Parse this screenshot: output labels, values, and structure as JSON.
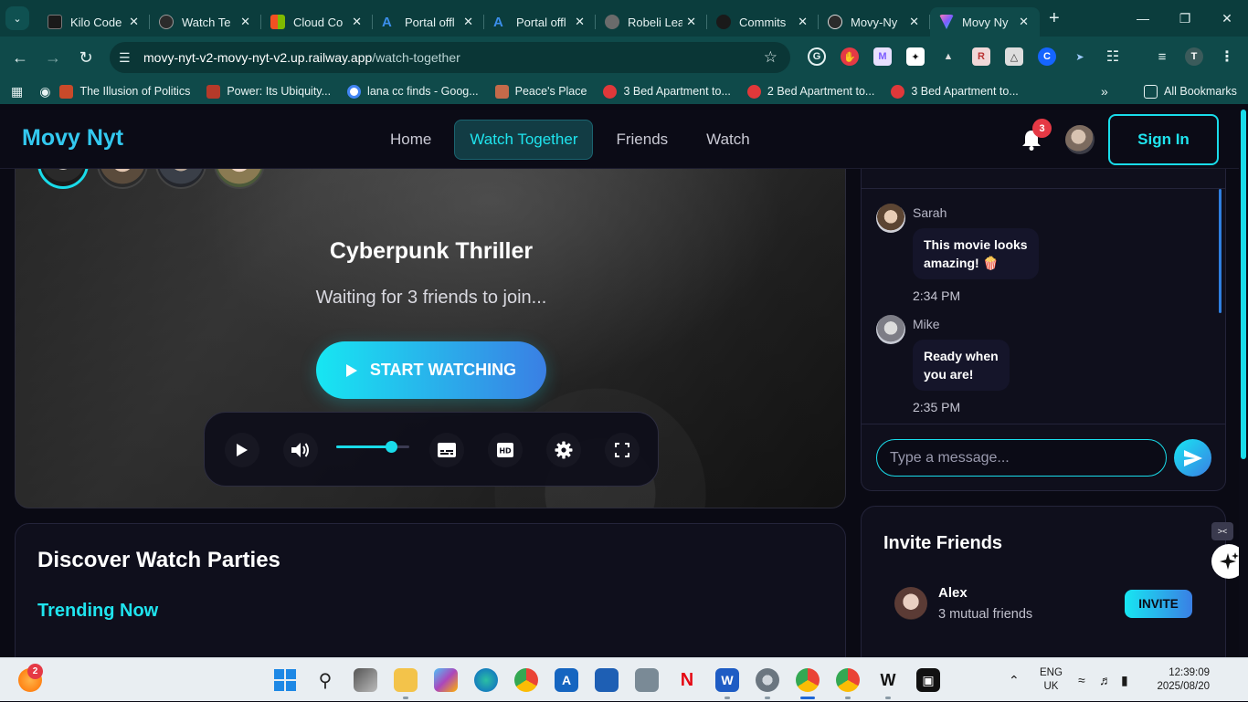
{
  "browser": {
    "tabs": [
      {
        "title": "Kilo Code",
        "color": "#1a1a1a",
        "active": false
      },
      {
        "title": "Watch Te",
        "color": "#2b2b2b",
        "active": false
      },
      {
        "title": "Cloud Co",
        "color": "#f25022",
        "active": false
      },
      {
        "title": "Portal offl",
        "color": "#0f6cbd",
        "active": false
      },
      {
        "title": "Portal offl",
        "color": "#0f6cbd",
        "active": false
      },
      {
        "title": "Robeli Lea",
        "color": "#6b6b6b",
        "active": false
      },
      {
        "title": "Commits",
        "color": "#1a1a1a",
        "active": false
      },
      {
        "title": "Movy-Ny",
        "color": "#2b2b2b",
        "active": false
      },
      {
        "title": "Movy Ny",
        "color": "#7b5cff",
        "active": true
      }
    ],
    "url_host": "movy-nyt-v2-movy-nyt-v2.up.railway.app",
    "url_path": "/watch-together",
    "bookmarks": [
      {
        "label": "The Illusion of Politics",
        "color": "#c94a2a"
      },
      {
        "label": "Power: Its Ubiquity...",
        "color": "#b53a2a"
      },
      {
        "label": "lana cc finds - Goog...",
        "color": "#4285f4"
      },
      {
        "label": "Peace's Place",
        "color": "#c46a4a"
      },
      {
        "label": "3 Bed Apartment to...",
        "color": "#e0383a"
      },
      {
        "label": "2 Bed Apartment to...",
        "color": "#e0383a"
      },
      {
        "label": "3 Bed Apartment to...",
        "color": "#e0383a"
      }
    ],
    "all_bookmarks": "All Bookmarks",
    "profile_initial": "T"
  },
  "site": {
    "logo": "Movy Nyt",
    "nav": [
      "Home",
      "Watch Together",
      "Friends",
      "Watch"
    ],
    "active_nav": "Watch Together",
    "notification_count": "3",
    "sign_in": "Sign In"
  },
  "player": {
    "title": "Cyberpunk Thriller",
    "waiting": "Waiting for 3 friends to join...",
    "start_label": "START WATCHING",
    "volume_level": 0.75
  },
  "chat": {
    "messages": [
      {
        "user": "Sarah",
        "text_line1": "This movie looks",
        "text_line2": "amazing! 🍿",
        "time": "2:34 PM"
      },
      {
        "user": "Mike",
        "text_line1": "Ready when",
        "text_line2": "you are!",
        "time": "2:35 PM"
      }
    ],
    "placeholder": "Type a message..."
  },
  "discover": {
    "title": "Discover Watch Parties",
    "subtitle": "Trending Now"
  },
  "invite": {
    "title": "Invite Friends",
    "friend": {
      "name": "Alex",
      "mutual": "3 mutual friends",
      "button": "INVITE"
    }
  },
  "taskbar": {
    "notif_count": "2",
    "lang_1": "ENG",
    "lang_2": "UK",
    "time": "12:39:09",
    "date": "2025/08/20"
  }
}
